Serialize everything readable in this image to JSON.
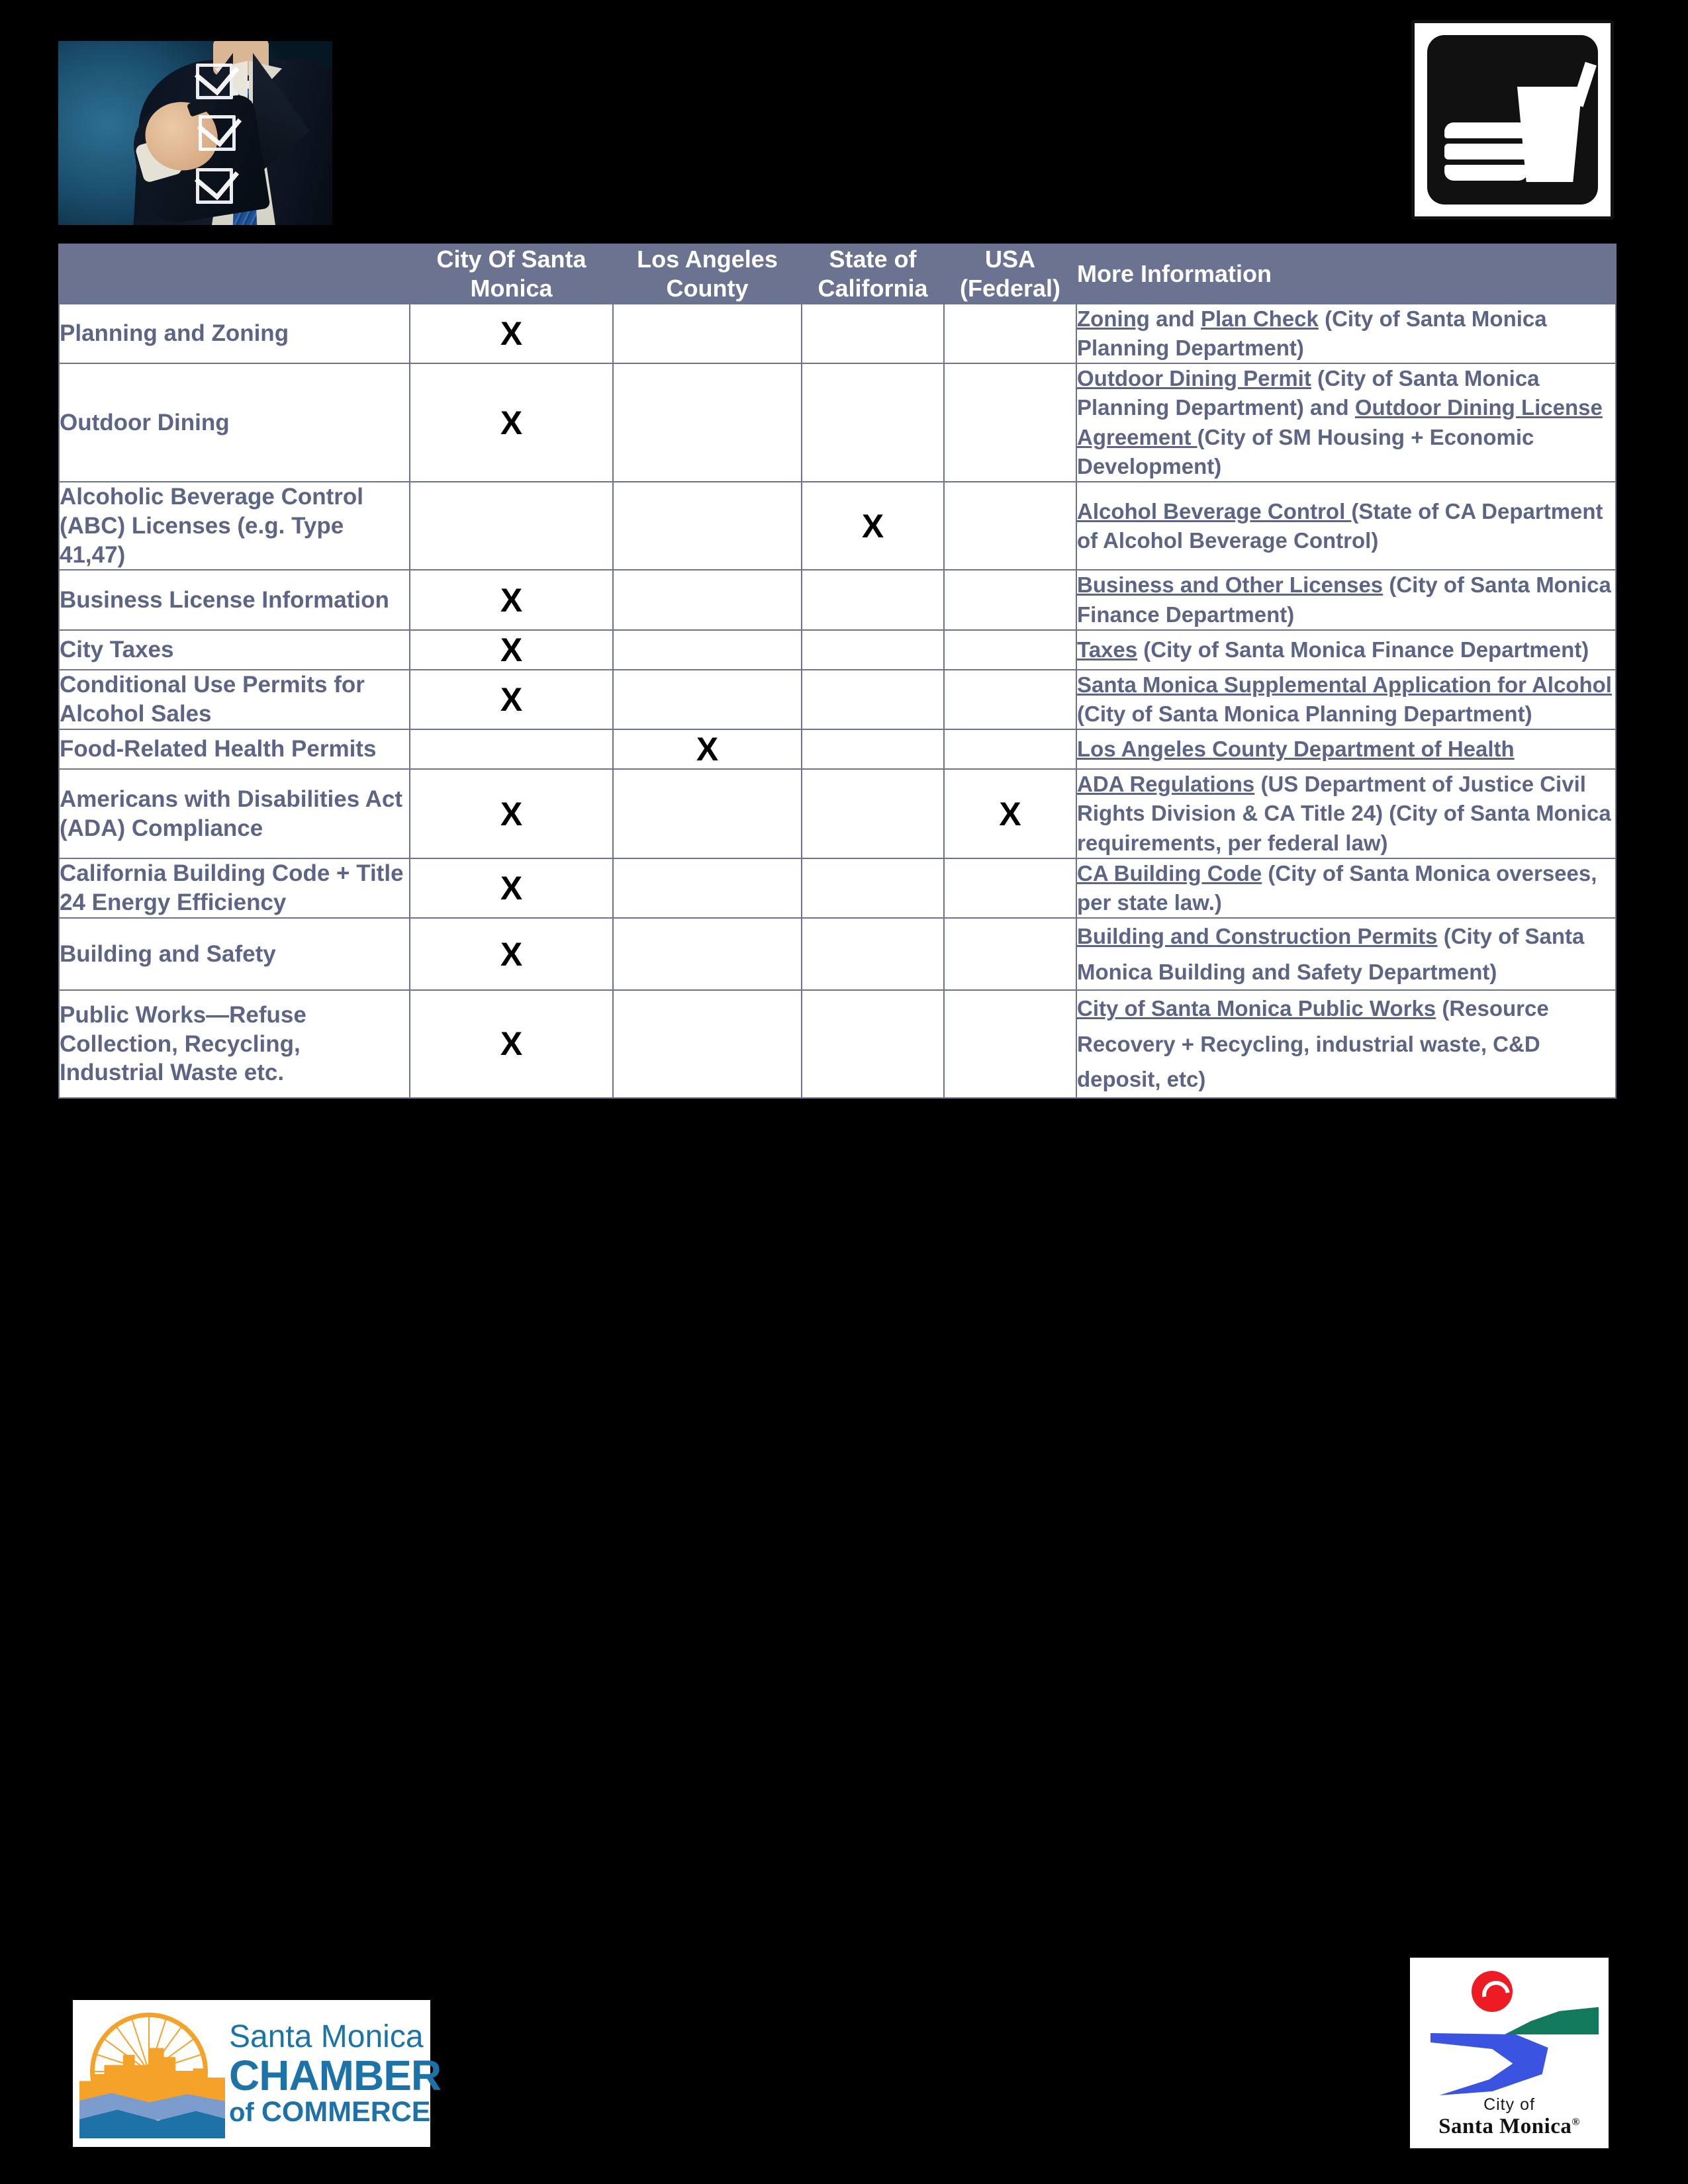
{
  "header_images": {
    "checklist_photo_alt": "businessman-checking-boxes-photo",
    "food_icon_alt": "burger-and-drink-icon"
  },
  "table": {
    "columns": [
      {
        "key": "topic",
        "line1": "",
        "line2": ""
      },
      {
        "key": "city",
        "line1": "City Of  Santa",
        "line2": "Monica"
      },
      {
        "key": "county",
        "line1": "Los  Angeles",
        "line2": "County"
      },
      {
        "key": "state",
        "line1": "State of",
        "line2": "California"
      },
      {
        "key": "usa",
        "line1": "USA",
        "line2": "(Federal)"
      },
      {
        "key": "moreinfo",
        "line1": "More  Information",
        "line2": ""
      }
    ],
    "mark": "X",
    "rows": [
      {
        "topic": "Planning and Zoning",
        "city": "X",
        "county": "",
        "state": "",
        "usa": "",
        "info_parts": [
          {
            "text": "Zoning",
            "link": true
          },
          {
            "text": "  and ",
            "link": false
          },
          {
            "text": "Plan Check",
            "link": true
          },
          {
            "text": " (City of Santa Monica Planning Department)",
            "link": false
          }
        ]
      },
      {
        "topic": "Outdoor Dining",
        "city": "X",
        "county": "",
        "state": "",
        "usa": "",
        "info_parts": [
          {
            "text": "Outdoor Dining Permit",
            "link": true
          },
          {
            "text": " (City of Santa Monica  Planning Department) and ",
            "link": false
          },
          {
            "text": "Outdoor Dining License Agreement ",
            "link": true
          },
          {
            "text": "(City of SM Housing + Economic Development)",
            "link": false
          }
        ]
      },
      {
        "topic": "Alcoholic Beverage Control (ABC) Licenses (e.g. Type 41,47)",
        "city": "",
        "county": "",
        "state": "X",
        "usa": "",
        "info_parts": [
          {
            "text": "Alcohol Beverage Control ",
            "link": true
          },
          {
            "text": "(State of CA Department of Alcohol Beverage Control)",
            "link": false
          }
        ]
      },
      {
        "topic": "Business License Information",
        "city": "X",
        "county": "",
        "state": "",
        "usa": "",
        "info_parts": [
          {
            "text": "Business and Other  Licenses",
            "link": true
          },
          {
            "text": " (City of Santa Monica Finance Department)",
            "link": false
          }
        ]
      },
      {
        "topic": "City Taxes",
        "city": "X",
        "county": "",
        "state": "",
        "usa": "",
        "info_parts": [
          {
            "text": "Taxes",
            "link": true
          },
          {
            "text": " (City of Santa Monica Finance Department)",
            "link": false
          }
        ]
      },
      {
        "topic": "Conditional Use Permits for Alcohol Sales",
        "city": "X",
        "county": "",
        "state": "",
        "usa": "",
        "info_parts": [
          {
            "text": "Santa Monica Supplemental  Application for Alcohol",
            "link": true
          },
          {
            "text": " (City of Santa Monica Planning Department)",
            "link": false
          }
        ]
      },
      {
        "topic": "Food-Related Health Permits",
        "city": "",
        "county": "X",
        "state": "",
        "usa": "",
        "info_parts": [
          {
            "text": "Los Angeles County Department of Health",
            "link": true
          }
        ]
      },
      {
        "topic": "Americans with Disabilities Act (ADA) Compliance",
        "city": "X",
        "county": "",
        "state": "",
        "usa": "X",
        "info_parts": [
          {
            "text": "ADA Regulations",
            "link": true
          },
          {
            "text": " (US Department of Justice Civil Rights Division & CA Title 24) (City of Santa Monica requirements, per federal law)",
            "link": false
          }
        ]
      },
      {
        "topic": "California Building Code + Title 24 Energy Efficiency",
        "city": "X",
        "county": "",
        "state": "",
        "usa": "",
        "info_parts": [
          {
            "text": "CA Building Code",
            "link": true
          },
          {
            "text": " (City of Santa Monica oversees, per state law.)",
            "link": false
          }
        ]
      },
      {
        "topic": "Building and Safety",
        "city": "X",
        "county": "",
        "state": "",
        "usa": "",
        "loose": true,
        "info_parts": [
          {
            "text": "Building and Construction Permits",
            "link": true
          },
          {
            "text": " (City of Santa Monica Building and Safety Department)",
            "link": false
          }
        ]
      },
      {
        "topic": "Public Works—Refuse Collection, Recycling, Industrial Waste etc.",
        "city": "X",
        "county": "",
        "state": "",
        "usa": "",
        "loose": true,
        "info_parts": [
          {
            "text": "City of Santa Monica Public Works",
            "link": true
          },
          {
            "text": " (Resource Recovery + Recycling, industrial waste, C&D deposit, etc)",
            "link": false
          }
        ]
      }
    ]
  },
  "footer": {
    "chamber_logo": {
      "line1": "Santa Monica",
      "line2": "CHAMBER",
      "line3_small": "of ",
      "line3_big": "COMMERCE"
    },
    "city_logo": {
      "line1": "City of",
      "line2": "Santa Monica",
      "trademark": "®"
    }
  },
  "colors": {
    "header_bg": "#6b7391",
    "text_slate": "#5c6585",
    "border": "#6b7391",
    "chamber_blue": "#1d72a8",
    "chamber_orange": "#f5a22b",
    "city_red": "#ed1c24",
    "city_green": "#12795c",
    "city_blue": "#3a53e0",
    "page_bg": "#000000"
  }
}
